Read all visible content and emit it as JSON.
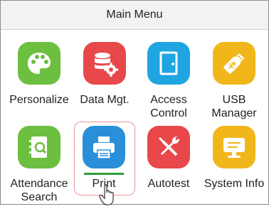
{
  "window": {
    "title": "Main Menu"
  },
  "menu": {
    "items": [
      {
        "label": "Personalize",
        "icon": "palette-icon",
        "color": "#6cbf3f"
      },
      {
        "label": "Data Mgt.",
        "icon": "database-gear-icon",
        "color": "#e8484a"
      },
      {
        "label": "Access\nControl",
        "icon": "door-icon",
        "color": "#1fa6e0"
      },
      {
        "label": "USB\nManager",
        "icon": "usb-drive-icon",
        "color": "#f1b619"
      },
      {
        "label": "Attendance\nSearch",
        "icon": "address-book-search-icon",
        "color": "#6cbf3f"
      },
      {
        "label": "Print",
        "icon": "printer-icon",
        "color": "#2a8fd8",
        "selected": true
      },
      {
        "label": "Autotest",
        "icon": "tools-icon",
        "color": "#e8484a"
      },
      {
        "label": "System Info",
        "icon": "info-screen-icon",
        "color": "#f1b619"
      }
    ]
  },
  "pointer": {
    "icon": "hand-pointer-icon"
  }
}
